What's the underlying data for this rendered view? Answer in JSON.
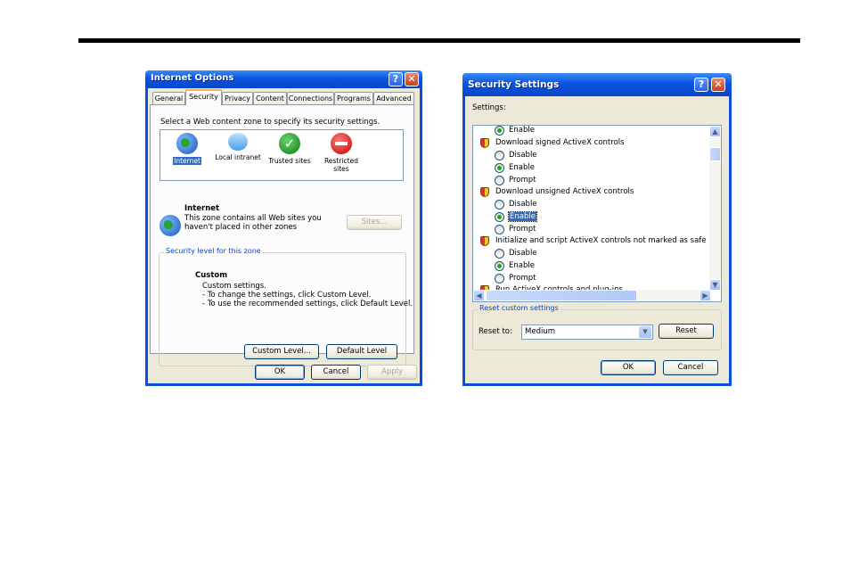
{
  "internet_options": {
    "title": "Internet Options",
    "tabs": [
      "General",
      "Security",
      "Privacy",
      "Content",
      "Connections",
      "Programs",
      "Advanced"
    ],
    "instruction": "Select a Web content zone to specify its security settings.",
    "zones": [
      {
        "label": "Internet",
        "icon": "globe-icon"
      },
      {
        "label": "Local intranet",
        "icon": "monitor-icon"
      },
      {
        "label": "Trusted sites",
        "icon": "check-icon"
      },
      {
        "label": "Restricted\nsites",
        "icon": "no-entry-icon"
      }
    ],
    "zone_heading": "Internet",
    "zone_desc_line1": "This zone contains all Web sites you",
    "zone_desc_line2": "haven't placed in other zones",
    "sites_button": "Sites...",
    "security_level_legend": "Security level for this zone",
    "level_title": "Custom",
    "level_line1": "Custom settings.",
    "level_line2": "- To change the settings, click Custom Level.",
    "level_line3": "- To use the recommended settings, click Default Level.",
    "custom_level_button": "Custom Level...",
    "default_level_button": "Default Level",
    "ok": "OK",
    "cancel": "Cancel",
    "apply": "Apply"
  },
  "security_settings": {
    "title": "Security Settings",
    "settings_label": "Settings:",
    "items": {
      "enable_top": "Enable",
      "group1": "Download signed ActiveX controls",
      "g1_disable": "Disable",
      "g1_enable": "Enable",
      "g1_prompt": "Prompt",
      "group2": "Download unsigned ActiveX controls",
      "g2_disable": "Disable",
      "g2_enable": "Enable",
      "g2_prompt": "Prompt",
      "group3": "Initialize and script ActiveX controls not marked as safe",
      "g3_disable": "Disable",
      "g3_enable": "Enable",
      "g3_prompt": "Prompt",
      "group4_partial": "Run ActiveX controls and plug-ins"
    },
    "reset_legend": "Reset custom settings",
    "reset_to_label": "Reset to:",
    "reset_to_value": "Medium",
    "reset_button": "Reset",
    "ok": "OK",
    "cancel": "Cancel"
  }
}
